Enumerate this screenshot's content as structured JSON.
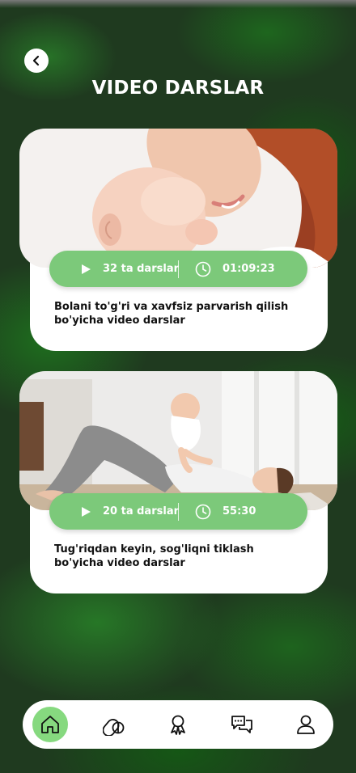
{
  "header": {
    "title": "VIDEO DARSLAR"
  },
  "courses": [
    {
      "lessons": "32 ta darslar",
      "duration": "01:09:23",
      "description": "Bolani to'g'ri va xavfsiz parvarish qilish bo'yicha video darslar"
    },
    {
      "lessons": "20 ta darslar",
      "duration": "55:30",
      "description": "Tug'riqdan keyin, sog'liqni tiklash bo'yicha video darslar"
    }
  ],
  "nav": {
    "items": [
      "home-icon",
      "pills-icon",
      "award-icon",
      "chat-icon",
      "user-icon"
    ],
    "active": "home-icon"
  },
  "colors": {
    "accent": "#7cc97a",
    "nav_active": "#86d97f",
    "background": "#1f3a1f"
  }
}
